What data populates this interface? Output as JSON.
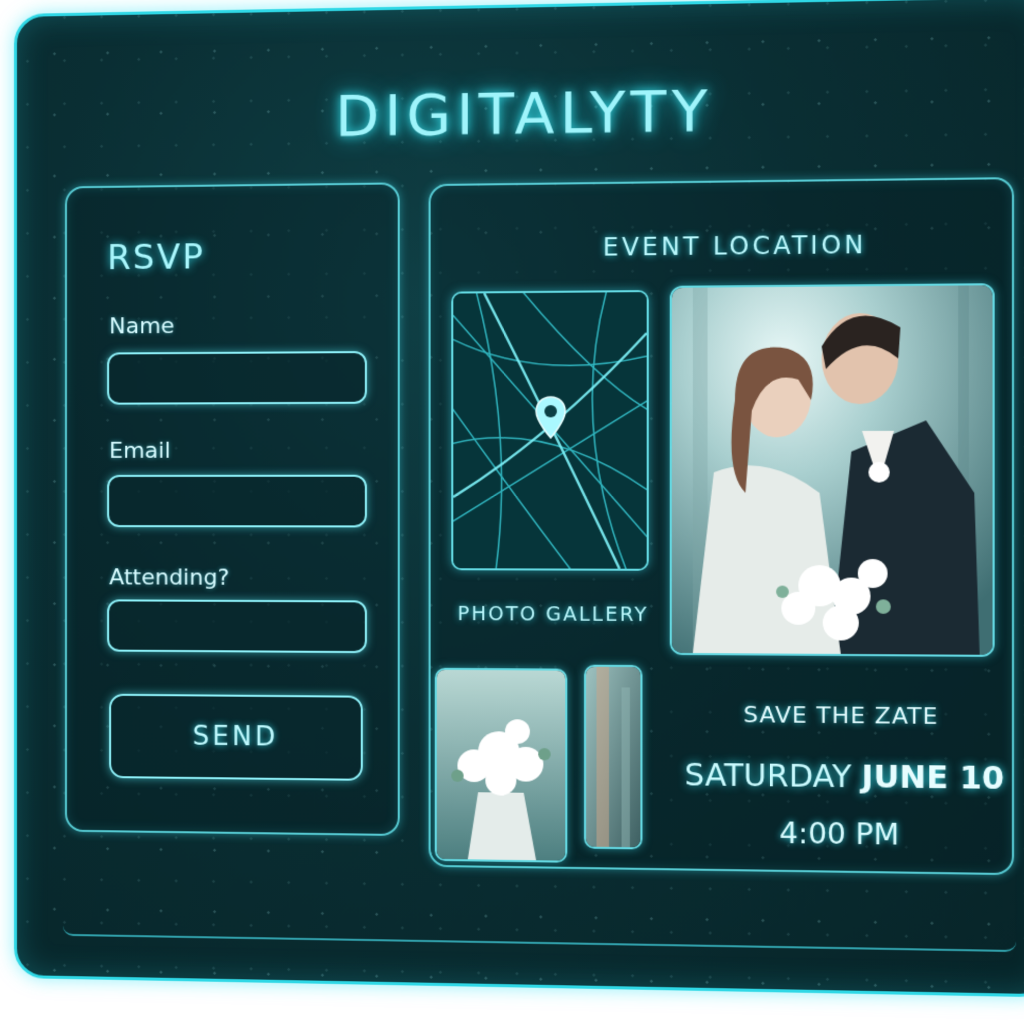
{
  "app": {
    "title": "DIGITALYTY"
  },
  "rsvp": {
    "title": "RSVP",
    "fields": [
      {
        "label": "Name",
        "value": ""
      },
      {
        "label": "Email",
        "value": ""
      },
      {
        "label": "Attending?",
        "value": ""
      }
    ],
    "send_label": "SEND"
  },
  "event": {
    "location_title": "EVENT LOCATION",
    "map_icon": "location-pin-icon",
    "gallery_title": "PHOTO GALLERY",
    "save_label": "SAVE THE ZATE",
    "date_day": "SATURDAY",
    "date_rest": "JUNE 10",
    "time": "4:00 PM"
  },
  "colors": {
    "accent": "#2fd8e6",
    "panel_bg": "#0a2e33",
    "text_glow": "#9ff4fb"
  }
}
